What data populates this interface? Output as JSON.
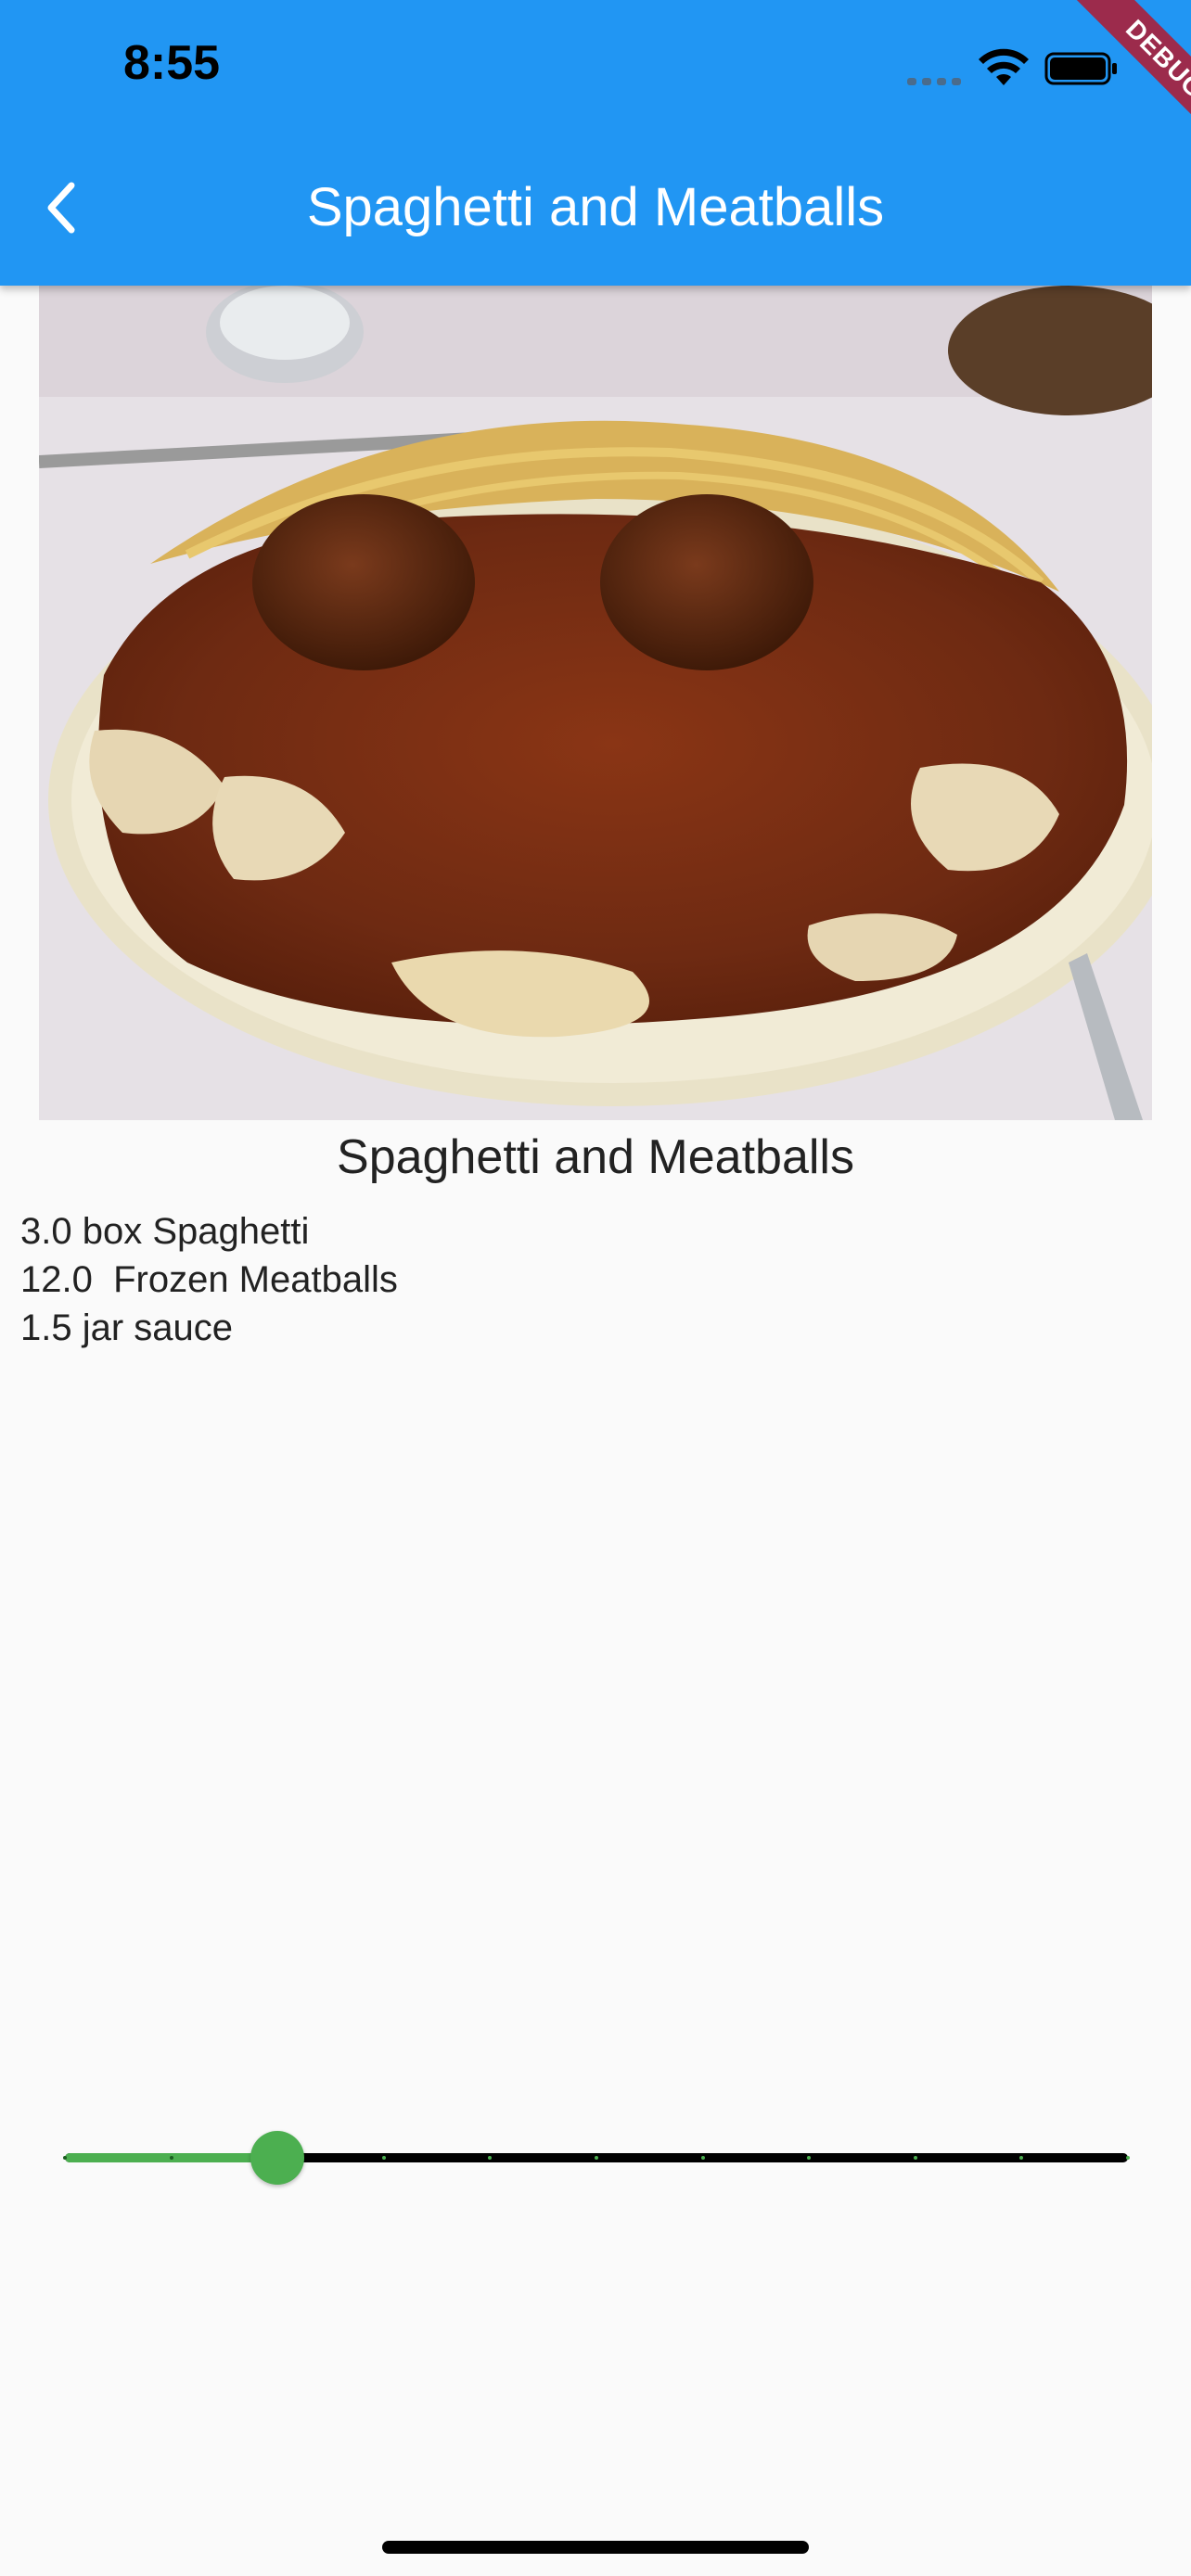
{
  "status_bar": {
    "time": "8:55"
  },
  "app_bar": {
    "title": "Spaghetti and Meatballs",
    "back_icon": "chevron-left-icon"
  },
  "debug_banner": {
    "label": "DEBUG"
  },
  "recipe": {
    "name": "Spaghetti and Meatballs",
    "ingredients": [
      "3.0 box Spaghetti",
      "12.0  Frozen Meatballs",
      "1.5 jar sauce"
    ]
  },
  "servings_slider": {
    "min": 1,
    "max": 11,
    "value": 3,
    "divisions": 10
  },
  "colors": {
    "app_bar": "#2196f3",
    "slider_active": "#4caf50",
    "slider_inactive": "#000000",
    "debug_banner": "#9c2b4c",
    "background": "#fafafa"
  }
}
